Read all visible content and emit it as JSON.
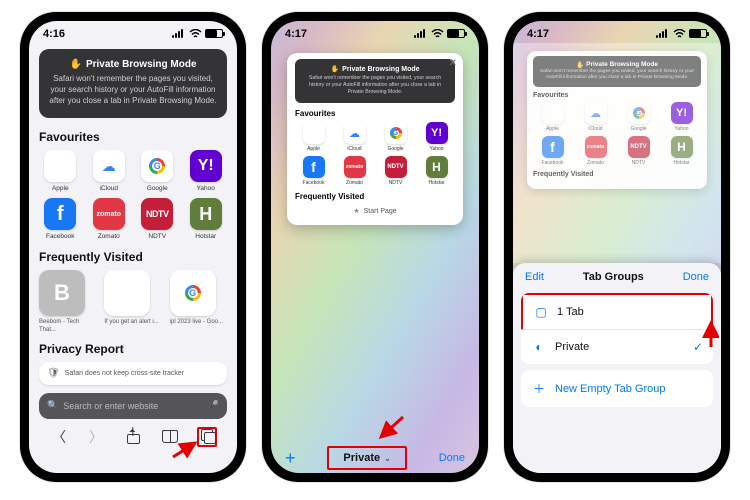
{
  "status": {
    "time1": "4:16",
    "time2": "4:17",
    "time3": "4:17"
  },
  "banner": {
    "title": "Private Browsing Mode",
    "message": "Safari won't remember the pages you visited, your search history or your AutoFill information after you close a tab in Private Browsing Mode."
  },
  "sections": {
    "favourites": "Favourites",
    "frequently_visited": "Frequently Visited",
    "privacy_report": "Privacy Report"
  },
  "favourites": [
    {
      "label": "Apple",
      "kind": "apple"
    },
    {
      "label": "iCloud",
      "kind": "icloud"
    },
    {
      "label": "Google",
      "kind": "google"
    },
    {
      "label": "Yahoo",
      "kind": "yahoo",
      "glyph": "Y!"
    },
    {
      "label": "Facebook",
      "kind": "fb",
      "glyph": "f"
    },
    {
      "label": "Zomato",
      "kind": "zomato",
      "glyph": "zomato"
    },
    {
      "label": "NDTV",
      "kind": "ndtv",
      "glyph": "NDTV"
    },
    {
      "label": "Hotstar",
      "kind": "hotstar",
      "glyph": "H"
    }
  ],
  "visited": [
    {
      "label": "Beebom - Tech That...",
      "kind": "grey",
      "glyph": "B"
    },
    {
      "label": "If you get an alert i...",
      "kind": "apple"
    },
    {
      "label": "ipl 2023 live - Goo...",
      "kind": "google"
    }
  ],
  "privacy_card": "Safari does not keep cross-site tracker",
  "search": {
    "placeholder": "Search or enter website"
  },
  "tabview": {
    "start_page": "Start Page",
    "new": "+",
    "center": "Private",
    "done": "Done"
  },
  "sheet": {
    "edit": "Edit",
    "title": "Tab Groups",
    "done": "Done",
    "rows": {
      "one_tab": "1 Tab",
      "private": "Private",
      "new_group": "New Empty Tab Group"
    }
  }
}
